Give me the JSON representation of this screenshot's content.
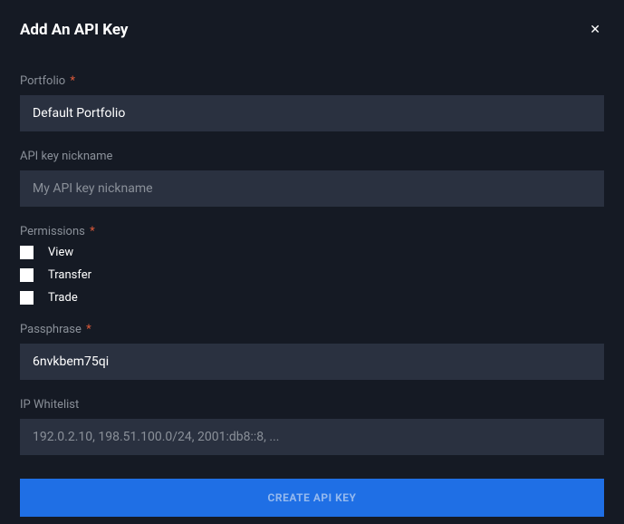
{
  "dialog": {
    "title": "Add An API Key"
  },
  "fields": {
    "portfolio": {
      "label": "Portfolio",
      "value": "Default Portfolio",
      "required": true
    },
    "nickname": {
      "label": "API key nickname",
      "placeholder": "My API key nickname",
      "value": "",
      "required": false
    },
    "permissions": {
      "label": "Permissions",
      "required": true,
      "options": [
        "View",
        "Transfer",
        "Trade"
      ]
    },
    "passphrase": {
      "label": "Passphrase",
      "value": "6nvkbem75qi",
      "required": true
    },
    "ip_whitelist": {
      "label": "IP Whitelist",
      "placeholder": "192.0.2.10, 198.51.100.0/24, 2001:db8::8, ...",
      "value": "",
      "required": false
    }
  },
  "actions": {
    "submit_label": "CREATE API KEY"
  },
  "required_mark": "*"
}
